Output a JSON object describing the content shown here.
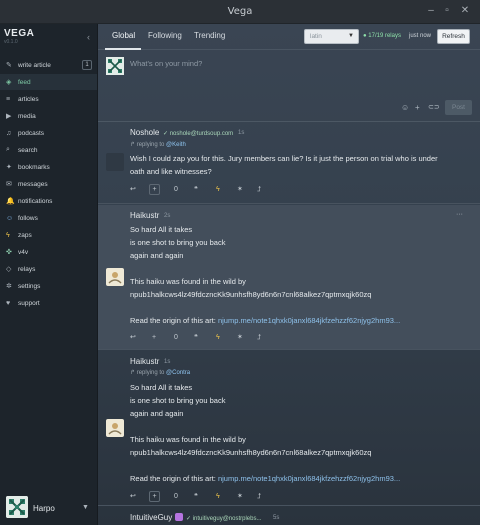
{
  "window": {
    "title": "Vega",
    "min": "–",
    "max": "▫",
    "close": "✕"
  },
  "sidebar": {
    "brand": "VEGA",
    "brand_sub": "v0.1.0",
    "collapse": "‹",
    "items": [
      {
        "icon": "✎",
        "label": "write article",
        "badge": "1"
      },
      {
        "icon": "◈",
        "label": "feed"
      },
      {
        "icon": "≡",
        "label": "articles"
      },
      {
        "icon": "▶",
        "label": "media"
      },
      {
        "icon": "♫",
        "label": "podcasts"
      },
      {
        "icon": "⌕",
        "label": "search"
      },
      {
        "icon": "✦",
        "label": "bookmarks"
      },
      {
        "icon": "✉",
        "label": "messages"
      },
      {
        "icon": "🔔",
        "label": "notifications"
      },
      {
        "icon": "☺",
        "label": "follows"
      },
      {
        "icon": "ϟ",
        "label": "zaps"
      },
      {
        "icon": "✜",
        "label": "v4v"
      },
      {
        "icon": "◇",
        "label": "relays"
      },
      {
        "icon": "✲",
        "label": "settings"
      },
      {
        "icon": "♥",
        "label": "support"
      }
    ],
    "user": {
      "name": "Harpo",
      "caret": "▼"
    }
  },
  "header": {
    "tabs": [
      "Global",
      "Following",
      "Trending"
    ],
    "lang_placeholder": "latin",
    "relays": "● 17/19 relays",
    "updated": "just now",
    "refresh": "Refresh"
  },
  "composer": {
    "placeholder": "What's on your mind?",
    "post": "Post",
    "icons": [
      "☺",
      "+",
      "⊂⊃"
    ]
  },
  "notes": [
    {
      "author": "Noshole",
      "nip05": "✓ noshole@turdsoup.com",
      "age": "1s",
      "reply_prefix": "↱ replying to ",
      "reply_to": "@Keith",
      "lines": [
        "Wish I could zap you for this. Jury members can lie? Is it just the person on trial who is under",
        "oath and like witnesses?"
      ],
      "count": "0"
    },
    {
      "author": "Haikustr",
      "age": "2s",
      "lines": [
        "So hard All it takes",
        "is one shot to bring you back",
        "again and again",
        "",
        "This haiku was found in the wild by",
        "npub1halkcws4lz49fdczncKk9unhsfh8yd6n6n7cnl68alkez7qptmxqjk60zq",
        ""
      ],
      "origin_prefix": "Read the origin of this art: ",
      "origin_link": "njump.me/note1qhxk0janxl684jkfzehzzf62njyg2hm93...",
      "count": "0"
    },
    {
      "author": "Haikustr",
      "age": "1s",
      "reply_prefix": "↱ replying to ",
      "reply_to": "@Contra",
      "lines": [
        "So hard All it takes",
        "is one shot to bring you back",
        "again and again",
        "",
        "This haiku was found in the wild by",
        "npub1halkcws4lz49fdczncKk9unhsfh8yd6n6n7cnl68alkez7qptmxqjk60zq",
        ""
      ],
      "origin_prefix": "Read the origin of this art: ",
      "origin_link": "njump.me/note1qhxk0janxl684jkfzehzzf62njyg2hm93...",
      "count": "0"
    },
    {
      "author": "IntuitiveGuy",
      "nip05": "✓ intuitiveguy@nostrplebs...",
      "age": "5s"
    }
  ],
  "action_icons": {
    "reply": "↩",
    "repost": "+",
    "quote": "❝",
    "zap": "ϟ",
    "like": "✶",
    "share": "⮥"
  },
  "more": "···"
}
